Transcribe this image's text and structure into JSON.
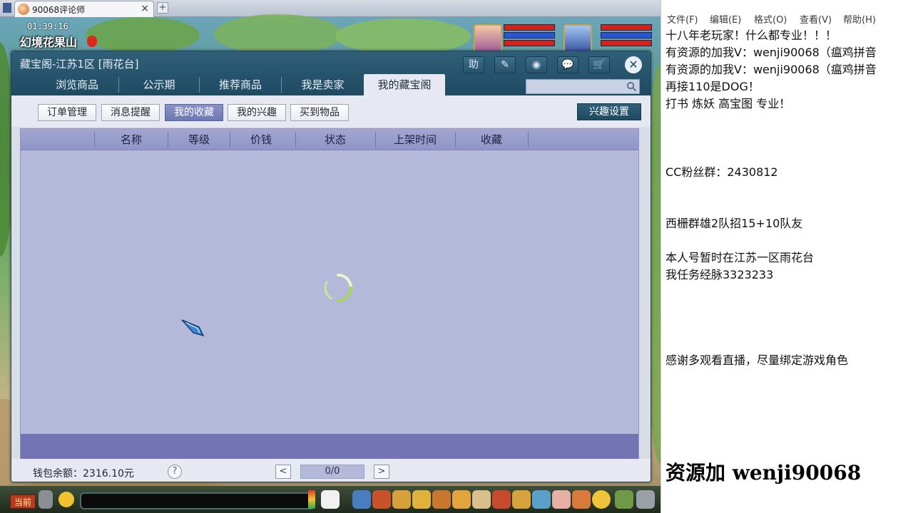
{
  "browser": {
    "tab_title": "90068评论师",
    "add_tab": "+"
  },
  "hud": {
    "clock": "01:39:16",
    "location": "幻境花果山"
  },
  "dialog": {
    "title": "藏宝阁-江苏1区 [雨花台]",
    "header_buttons": [
      "助",
      "✎",
      "◉",
      "💬",
      "🛒"
    ],
    "close": "✕",
    "nav_tabs": [
      "浏览商品",
      "公示期",
      "推荐商品",
      "我是卖家",
      "我的藏宝阁"
    ],
    "active_tab": "我的藏宝阁",
    "search": {
      "value": "",
      "placeholder": ""
    },
    "sub_buttons": [
      "订单管理",
      "消息提醒",
      "我的收藏",
      "我的兴趣",
      "买到物品"
    ],
    "active_sub": "我的收藏",
    "interest_settings": "兴趣设置",
    "table": {
      "columns": [
        "名称",
        "等级",
        "价钱",
        "状态",
        "上架时间",
        "收藏"
      ],
      "rows": []
    },
    "footer": {
      "wallet": "钱包余额：2316.10元",
      "help": "?",
      "prev": "<",
      "next": ">",
      "page": "0/0"
    }
  },
  "gamebar": {
    "channel": "当前"
  },
  "notepad": {
    "menu": [
      "文件(F)",
      "编辑(E)",
      "格式(O)",
      "查看(V)",
      "帮助(H)"
    ],
    "lines": [
      "十八年老玩家！什么都专业！！！",
      "有资源的加我V：wenji90068（瘟鸡拼音",
      "有资源的加我V：wenji90068（瘟鸡拼音",
      "再接110是DOG！",
      "打书 炼妖 高宝图  专业！",
      "",
      "",
      "",
      "CC粉丝群：2430812",
      "",
      "",
      "西栅群雄2队招15+10队友",
      "",
      "本人号暂时在江苏一区雨花台",
      "我任务经脉3323233",
      "",
      "",
      "",
      "",
      "感谢多观看直播，尽量绑定游戏角色"
    ],
    "big_line": "资源加 wenji90068"
  },
  "colors": {
    "dialog_header": "#1f4a62",
    "table_body": "#b5b9d9",
    "table_footer": "#7474b4",
    "active_sub": "#6d78b4"
  }
}
